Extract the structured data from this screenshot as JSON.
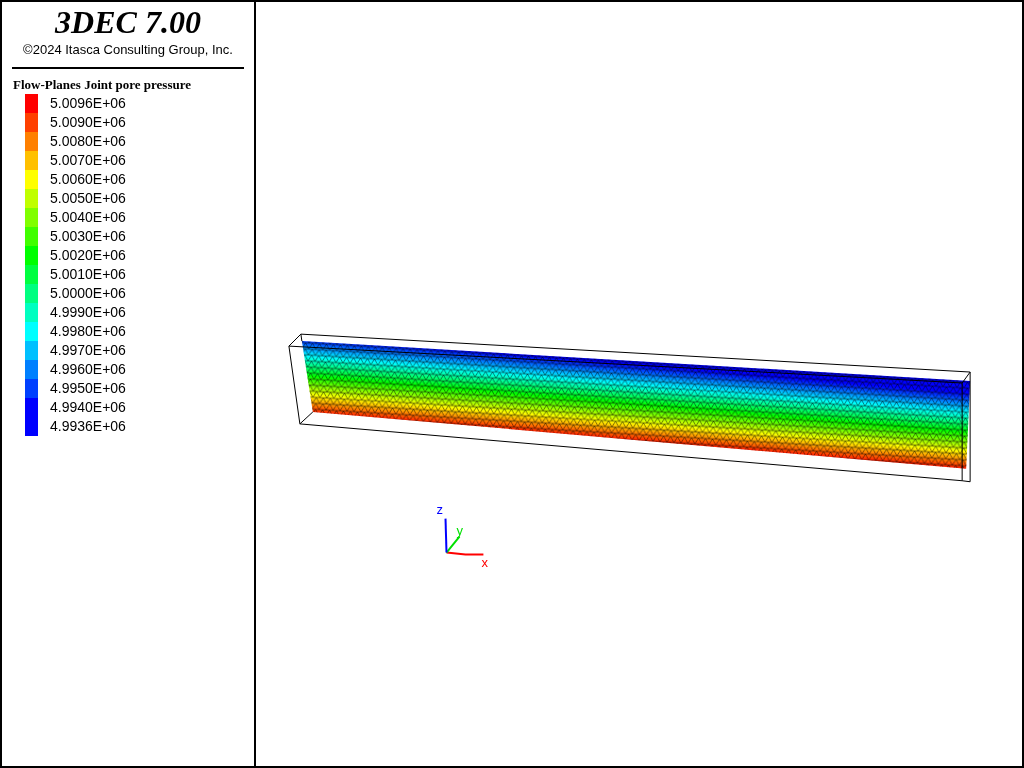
{
  "header": {
    "title": "3DEC 7.00",
    "copyright": "©2024 Itasca Consulting Group, Inc."
  },
  "legend": {
    "title": "Flow-Planes Joint pore pressure",
    "items": [
      {
        "label": "5.0096E+06",
        "color": "#ff0000"
      },
      {
        "label": "5.0090E+06",
        "color": "#ff4000"
      },
      {
        "label": "5.0080E+06",
        "color": "#ff8000"
      },
      {
        "label": "5.0070E+06",
        "color": "#ffc000"
      },
      {
        "label": "5.0060E+06",
        "color": "#ffff00"
      },
      {
        "label": "5.0050E+06",
        "color": "#c0ff00"
      },
      {
        "label": "5.0040E+06",
        "color": "#80ff00"
      },
      {
        "label": "5.0030E+06",
        "color": "#40ff00"
      },
      {
        "label": "5.0020E+06",
        "color": "#00ff00"
      },
      {
        "label": "5.0010E+06",
        "color": "#00ff40"
      },
      {
        "label": "5.0000E+06",
        "color": "#00ff80"
      },
      {
        "label": "4.9990E+06",
        "color": "#00ffc0"
      },
      {
        "label": "4.9980E+06",
        "color": "#00ffff"
      },
      {
        "label": "4.9970E+06",
        "color": "#00c0ff"
      },
      {
        "label": "4.9960E+06",
        "color": "#0080ff"
      },
      {
        "label": "4.9950E+06",
        "color": "#0040ff"
      },
      {
        "label": "4.9940E+06",
        "color": "#0000ff"
      },
      {
        "label": "4.9936E+06",
        "color": "#0000ff"
      }
    ]
  },
  "axes": [
    {
      "label": "x",
      "color": "#ff0000"
    },
    {
      "label": "y",
      "color": "#00e000"
    },
    {
      "label": "z",
      "color": "#0000ff"
    }
  ]
}
